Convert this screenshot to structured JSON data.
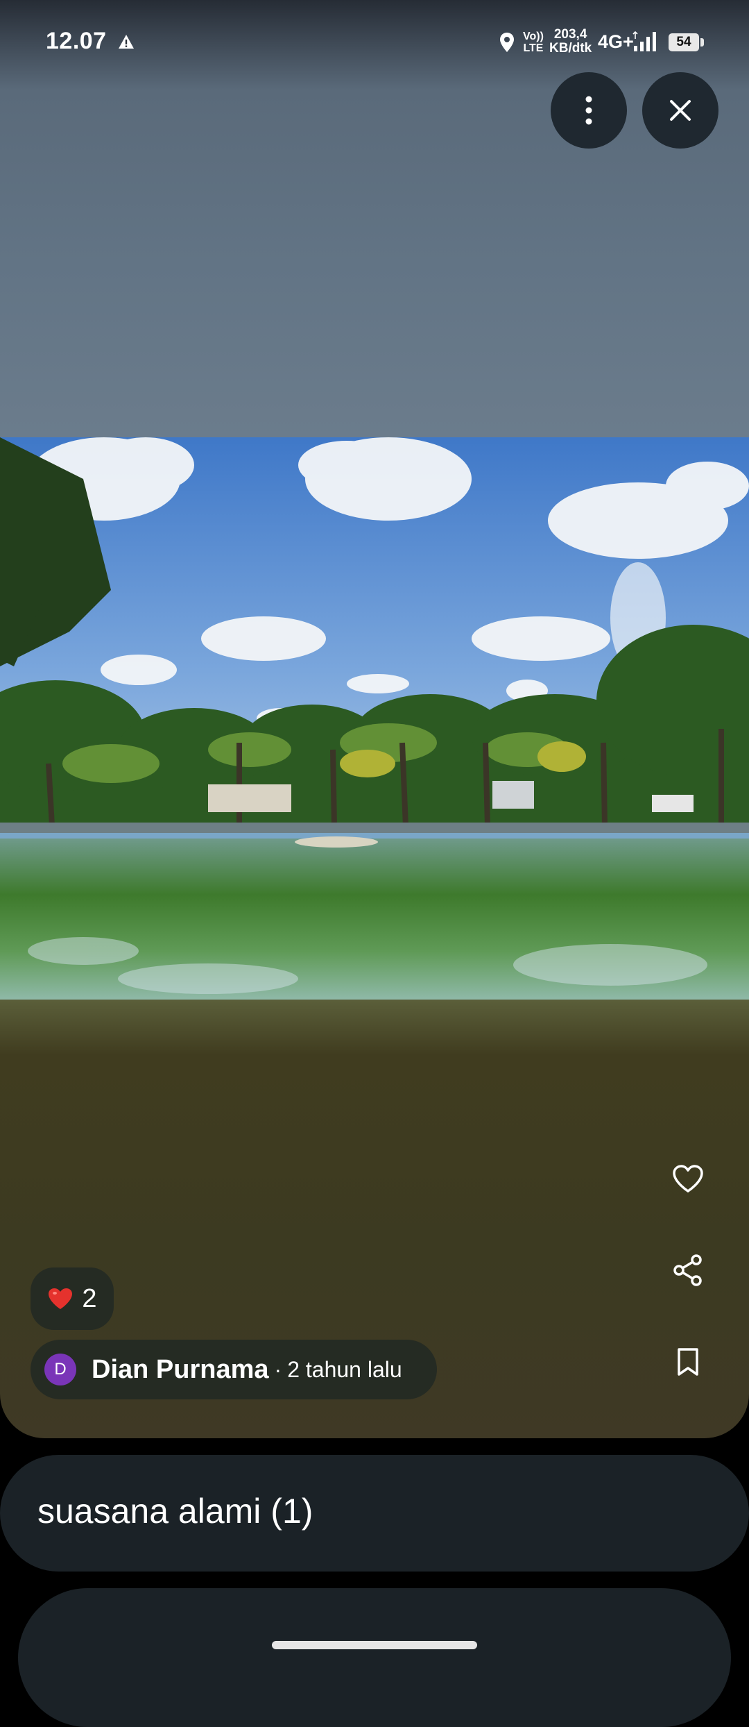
{
  "status_bar": {
    "time": "12.07",
    "volte_top": "Vo))",
    "volte_bottom": "LTE",
    "speed_value": "203,4",
    "speed_unit": "KB/dtk",
    "network": "4G+",
    "battery": "54",
    "icons": [
      "warning-icon",
      "location-icon",
      "signal-icon",
      "battery-icon"
    ]
  },
  "toolbar": {
    "more_icon": "more-vert-icon",
    "close_icon": "close-icon"
  },
  "post": {
    "reaction_emoji": "heart-emoji",
    "reaction_count": "2",
    "author_initial": "D",
    "author_name": "Dian Purnama",
    "separator": "·",
    "time_ago": "2 tahun lalu",
    "actions": [
      "heart-outline-icon",
      "share-icon",
      "bookmark-icon"
    ]
  },
  "album": {
    "title": "suasana alami (1)"
  },
  "colors": {
    "avatar": "#7a35b8",
    "chip_bg": "#252b23",
    "card_bg": "#1b2227",
    "heart": "#e5322d"
  }
}
